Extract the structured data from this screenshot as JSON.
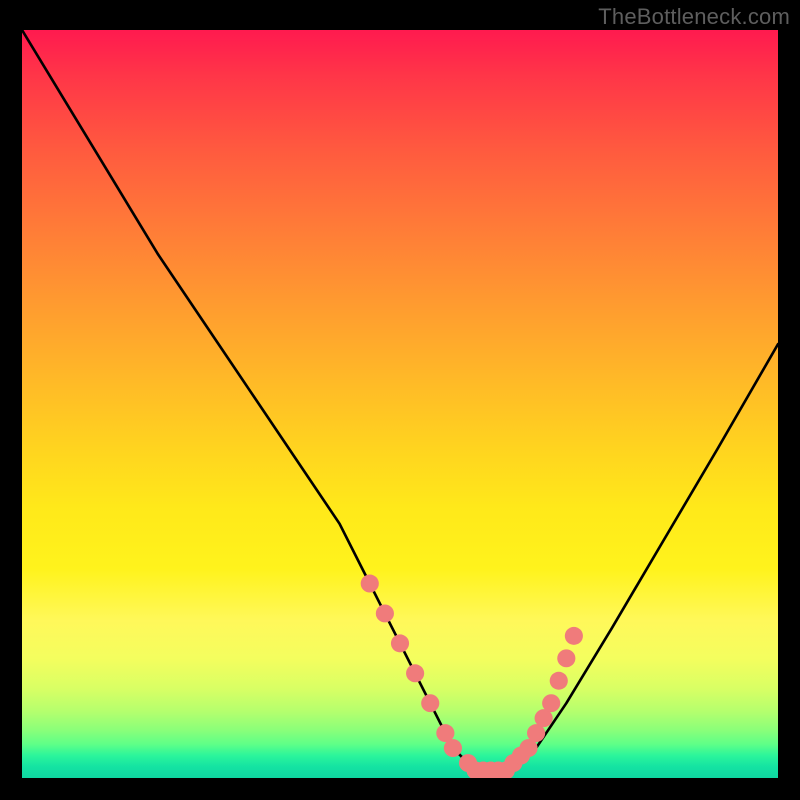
{
  "watermark": "TheBottleneck.com",
  "chart_data": {
    "type": "line",
    "title": "",
    "xlabel": "",
    "ylabel": "",
    "ylim": [
      0,
      100
    ],
    "xlim": [
      0,
      100
    ],
    "note": "x/y are in percent of the plot box; y=0 is bottom (minimum of the V), y=100 is top.",
    "curve": {
      "name": "bottleneck-curve",
      "x": [
        0,
        6,
        12,
        18,
        24,
        30,
        36,
        42,
        46,
        49,
        52,
        55,
        57,
        59,
        61,
        64,
        68,
        72,
        78,
        85,
        92,
        100
      ],
      "y": [
        100,
        90,
        80,
        70,
        61,
        52,
        43,
        34,
        26,
        20,
        14,
        8,
        4,
        2,
        1,
        1,
        4,
        10,
        20,
        32,
        44,
        58
      ]
    },
    "markers": {
      "name": "highlight-dots",
      "color": "#f07b7b",
      "x": [
        46,
        48,
        50,
        52,
        54,
        56,
        57,
        59,
        60,
        61,
        62,
        63,
        64,
        65,
        66,
        67,
        68,
        69,
        70,
        71,
        72,
        73
      ],
      "y": [
        26,
        22,
        18,
        14,
        10,
        6,
        4,
        2,
        1,
        1,
        1,
        1,
        1,
        2,
        3,
        4,
        6,
        8,
        10,
        13,
        16,
        19
      ]
    }
  }
}
